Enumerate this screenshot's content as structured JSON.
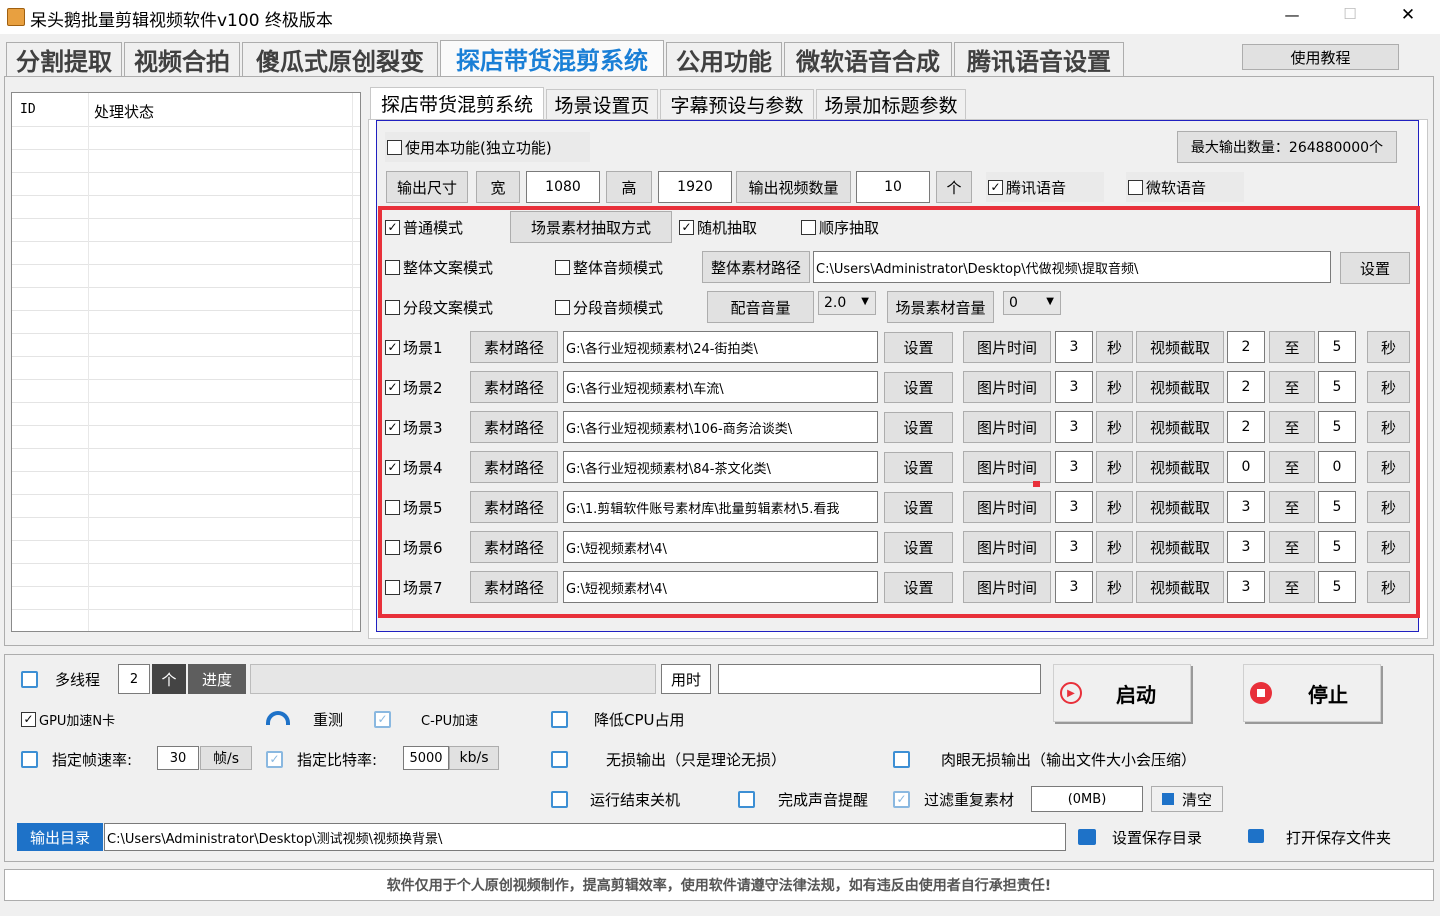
{
  "window": {
    "title": "呆头鹅批量剪辑视频软件v100 终极版本",
    "minimize": "—",
    "maximize": "☐",
    "close": "✕"
  },
  "main_tabs": [
    "分割提取",
    "视频合拍",
    "傻瓜式原创裂变",
    "探店带货混剪系统",
    "公用功能",
    "微软语音合成",
    "腾讯语音设置"
  ],
  "tutorial_button": "使用教程",
  "list": {
    "col_id": "ID",
    "col_status": "处理状态"
  },
  "sub_tabs": [
    "探店带货混剪系统",
    "场景设置页",
    "字幕预设与参数",
    "场景加标题参数"
  ],
  "top": {
    "use_function": "使用本功能(独立功能)",
    "max_output": "最大输出数量：264880000个",
    "output_size": "输出尺寸",
    "width_label": "宽",
    "width_value": "1080",
    "height_label": "高",
    "height_value": "1920",
    "output_count_label": "输出视频数量",
    "output_count_value": "10",
    "unit_ge": "个",
    "tencent_voice": "腾讯语音",
    "ms_voice": "微软语音"
  },
  "mode": {
    "normal": "普通模式",
    "extract_method": "场景素材抽取方式",
    "random": "随机抽取",
    "sequential": "顺序抽取",
    "whole_text": "整体文案模式",
    "whole_audio": "整体音频模式",
    "whole_path_btn": "整体素材路径",
    "whole_path": "C:\\Users\\Administrator\\Desktop\\代做视频\\提取音频\\",
    "set": "设置",
    "segment_text": "分段文案模式",
    "segment_audio": "分段音频模式",
    "dub_volume": "配音音量",
    "dub_volume_value": "2.0",
    "scene_volume": "场景素材音量",
    "scene_volume_value": "0"
  },
  "scene_labels": {
    "path_btn": "素材路径",
    "set": "设置",
    "img_time": "图片时间",
    "sec": "秒",
    "clip": "视频截取",
    "to": "至"
  },
  "scenes": [
    {
      "name": "场景1",
      "checked": true,
      "path": "G:\\各行业短视频素材\\24-街拍类\\",
      "img": "3",
      "from": "2",
      "to": "5"
    },
    {
      "name": "场景2",
      "checked": true,
      "path": "G:\\各行业短视频素材\\车流\\",
      "img": "3",
      "from": "2",
      "to": "5"
    },
    {
      "name": "场景3",
      "checked": true,
      "path": "G:\\各行业短视频素材\\106-商务洽谈类\\",
      "img": "3",
      "from": "2",
      "to": "5"
    },
    {
      "name": "场景4",
      "checked": true,
      "path": "G:\\各行业短视频素材\\84-茶文化类\\",
      "img": "3",
      "from": "0",
      "to": "0"
    },
    {
      "name": "场景5",
      "checked": false,
      "path": "G:\\1.剪辑软件账号素材库\\批量剪辑素材\\5.看我",
      "img": "3",
      "from": "3",
      "to": "5"
    },
    {
      "name": "场景6",
      "checked": false,
      "path": "G:\\短视频素材\\4\\",
      "img": "3",
      "from": "3",
      "to": "5"
    },
    {
      "name": "场景7",
      "checked": false,
      "path": "G:\\短视频素材\\4\\",
      "img": "3",
      "from": "3",
      "to": "5"
    }
  ],
  "bottom": {
    "multithread": "多线程",
    "threads": "2",
    "unit_ge": "个",
    "progress": "进度",
    "elapsed": "用时",
    "start": "启动",
    "stop": "停止",
    "gpu": "GPU加速N卡",
    "retest": "重测",
    "cpu_accel": "C-PU加速",
    "lower_cpu": "降低CPU占用",
    "fps_label": "指定帧速率:",
    "fps_value": "30",
    "fps_unit": "帧/s",
    "bitrate_label": "指定比特率:",
    "bitrate_value": "5000",
    "bitrate_unit": "kb/s",
    "lossless": "无损输出（只是理论无损）",
    "visual_lossless": "肉眼无损输出（输出文件大小会压缩）",
    "shutdown": "运行结束关机",
    "sound_alert": "完成声音提醒",
    "filter_dup": "过滤重复素材",
    "filter_size": "(0MB)",
    "clear": "清空",
    "output_dir_label": "输出目录",
    "output_dir": "C:\\Users\\Administrator\\Desktop\\测试视频\\视频换背景\\",
    "set_save_dir": "设置保存目录",
    "open_save_dir": "打开保存文件夹"
  },
  "footer": "软件仅用于个人原创视频制作，提高剪辑效率，使用软件请遵守法律法规，如有违反由使用者自行承担责任!",
  "colors": {
    "accent": "#1a7fd6",
    "highlight_border": "#e8303a",
    "output_label_bg": "#1e72c8"
  }
}
